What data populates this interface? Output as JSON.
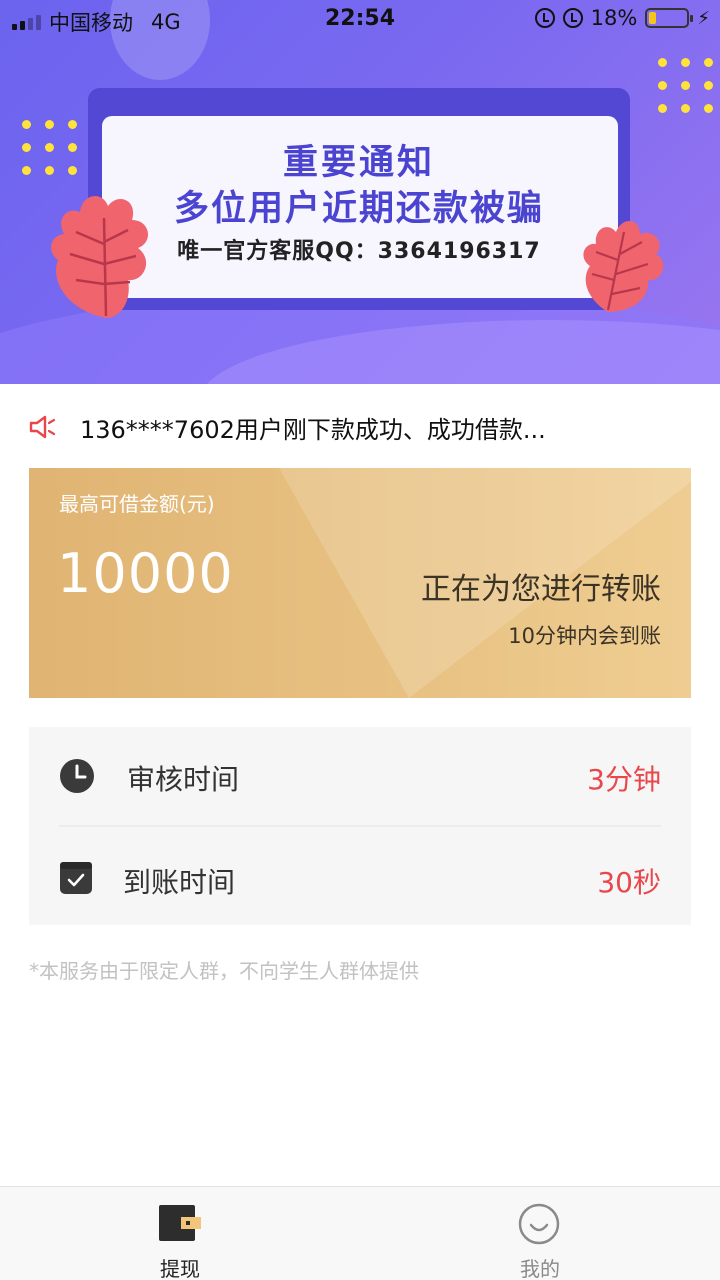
{
  "status_bar": {
    "carrier": "中国移动",
    "network": "4G",
    "time": "22:54",
    "battery_percent": "18%",
    "battery_level": 0.18
  },
  "banner": {
    "title": "重要通知",
    "subtitle": "多位用户近期还款被骗",
    "contact": "唯一官方客服QQ：3364196317"
  },
  "marquee": {
    "icon": "speaker-icon",
    "text": "136****7602用户刚下款成功、成功借款..."
  },
  "loan_card": {
    "label": "最高可借金额(元)",
    "amount": "10000",
    "status": "正在为您进行转账",
    "eta": "10分钟内会到账"
  },
  "timing": {
    "review": {
      "label": "审核时间",
      "value": "3分钟",
      "icon": "clock-icon"
    },
    "arrival": {
      "label": "到账时间",
      "value": "30秒",
      "icon": "checkbox-icon"
    }
  },
  "disclaimer": "*本服务由于限定人群，不向学生人群体提供",
  "tabs": [
    {
      "label": "提现",
      "icon": "wallet-icon",
      "active": true
    },
    {
      "label": "我的",
      "icon": "smiley-icon",
      "active": false
    }
  ],
  "colors": {
    "banner": "#7c6af0",
    "card_gold": "#e8c283",
    "accent_red": "#e8474c"
  }
}
